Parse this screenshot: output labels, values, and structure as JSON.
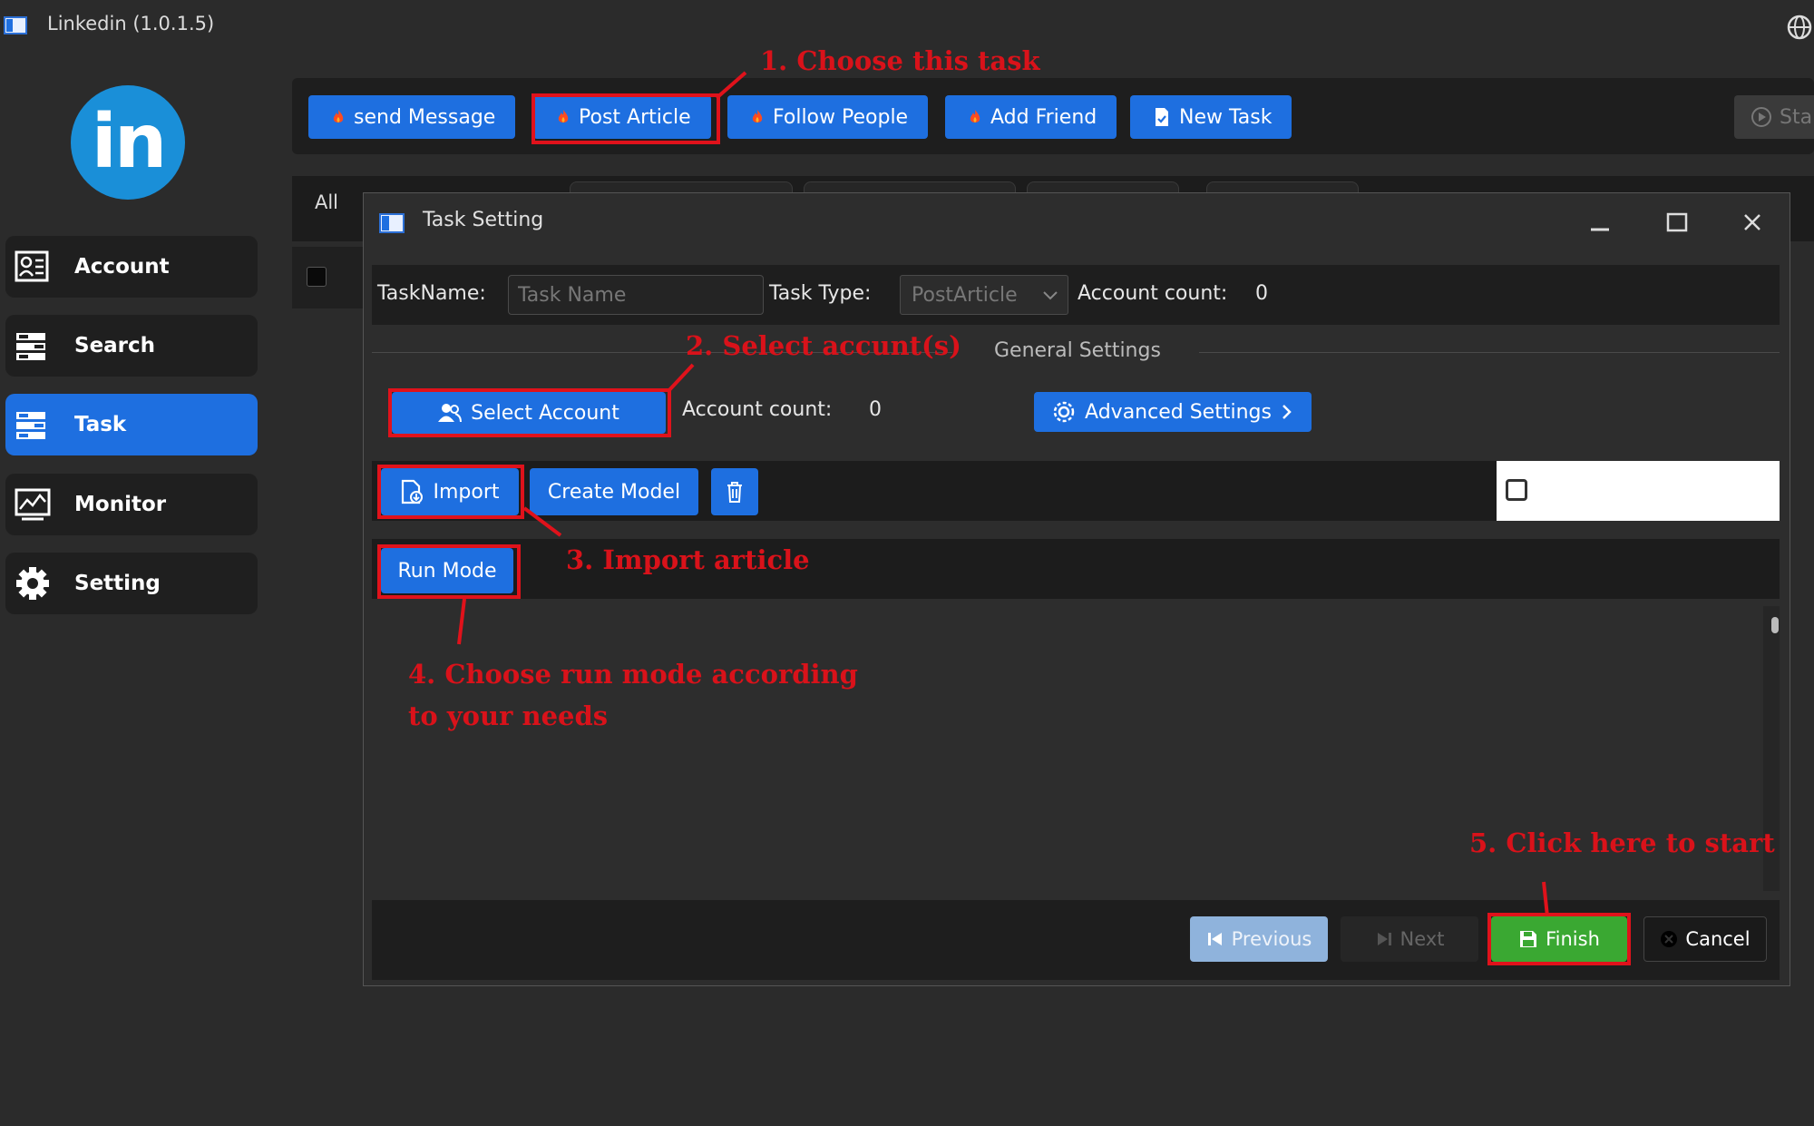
{
  "app": {
    "title": "Linkedin (1.0.1.5)",
    "logo_text": "in"
  },
  "sidebar": {
    "items": [
      {
        "label": "Account",
        "icon": "account-card-icon",
        "active": false
      },
      {
        "label": "Search",
        "icon": "search-list-icon",
        "active": false
      },
      {
        "label": "Task",
        "icon": "task-list-icon",
        "active": true
      },
      {
        "label": "Monitor",
        "icon": "monitor-chart-icon",
        "active": false
      },
      {
        "label": "Setting",
        "icon": "gear-icon",
        "active": false
      }
    ]
  },
  "toolbar": {
    "buttons": [
      {
        "label": "send Message",
        "icon": "flame-icon"
      },
      {
        "label": "Post Article",
        "icon": "flame-icon"
      },
      {
        "label": "Follow People",
        "icon": "flame-icon"
      },
      {
        "label": "Add Friend",
        "icon": "flame-icon"
      },
      {
        "label": "New Task",
        "icon": "new-document-icon"
      }
    ],
    "start_label": "Sta"
  },
  "background_tabs": {
    "all_label": "All"
  },
  "dialog": {
    "title": "Task Setting",
    "taskname_label": "TaskName:",
    "taskname_placeholder": "Task Name",
    "tasktype_label": "Task Type:",
    "tasktype_value": "PostArticle",
    "account_count_label": "Account count:",
    "account_count_value": "0",
    "general_settings_label": "General Settings",
    "select_account_label": "Select Account",
    "account_count_label_2": "Account count:",
    "account_count_value_2": "0",
    "advanced_settings_label": "Advanced Settings",
    "import_label": "Import",
    "create_model_label": "Create Model",
    "run_mode_label": "Run Mode",
    "footer": {
      "previous_label": "Previous",
      "next_label": "Next",
      "finish_label": "Finish",
      "cancel_label": "Cancel"
    }
  },
  "annotations": {
    "step1": "1. Choose this task",
    "step2": "2. Select accunt(s)",
    "step3": "3. Import article",
    "step4_line1": "4. Choose run mode according",
    "step4_line2": "to your needs",
    "step5": "5. Click here to start"
  },
  "colors": {
    "accent_blue": "#1e6fe0",
    "annotation_red": "#d9121a",
    "finish_green": "#3aa832",
    "background": "#2b2b2b"
  }
}
